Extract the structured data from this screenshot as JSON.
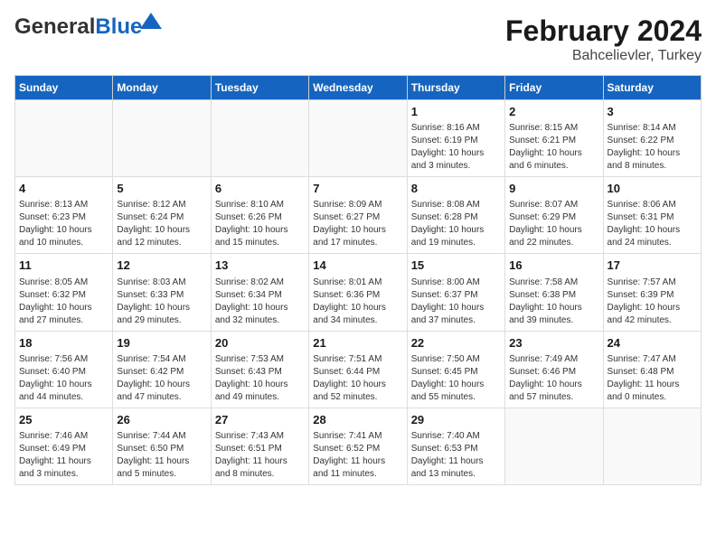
{
  "header": {
    "logo_general": "General",
    "logo_blue": "Blue",
    "month_title": "February 2024",
    "location": "Bahcelievler, Turkey"
  },
  "calendar": {
    "headers": [
      "Sunday",
      "Monday",
      "Tuesday",
      "Wednesday",
      "Thursday",
      "Friday",
      "Saturday"
    ],
    "weeks": [
      [
        {
          "day": "",
          "info": ""
        },
        {
          "day": "",
          "info": ""
        },
        {
          "day": "",
          "info": ""
        },
        {
          "day": "",
          "info": ""
        },
        {
          "day": "1",
          "info": "Sunrise: 8:16 AM\nSunset: 6:19 PM\nDaylight: 10 hours\nand 3 minutes."
        },
        {
          "day": "2",
          "info": "Sunrise: 8:15 AM\nSunset: 6:21 PM\nDaylight: 10 hours\nand 6 minutes."
        },
        {
          "day": "3",
          "info": "Sunrise: 8:14 AM\nSunset: 6:22 PM\nDaylight: 10 hours\nand 8 minutes."
        }
      ],
      [
        {
          "day": "4",
          "info": "Sunrise: 8:13 AM\nSunset: 6:23 PM\nDaylight: 10 hours\nand 10 minutes."
        },
        {
          "day": "5",
          "info": "Sunrise: 8:12 AM\nSunset: 6:24 PM\nDaylight: 10 hours\nand 12 minutes."
        },
        {
          "day": "6",
          "info": "Sunrise: 8:10 AM\nSunset: 6:26 PM\nDaylight: 10 hours\nand 15 minutes."
        },
        {
          "day": "7",
          "info": "Sunrise: 8:09 AM\nSunset: 6:27 PM\nDaylight: 10 hours\nand 17 minutes."
        },
        {
          "day": "8",
          "info": "Sunrise: 8:08 AM\nSunset: 6:28 PM\nDaylight: 10 hours\nand 19 minutes."
        },
        {
          "day": "9",
          "info": "Sunrise: 8:07 AM\nSunset: 6:29 PM\nDaylight: 10 hours\nand 22 minutes."
        },
        {
          "day": "10",
          "info": "Sunrise: 8:06 AM\nSunset: 6:31 PM\nDaylight: 10 hours\nand 24 minutes."
        }
      ],
      [
        {
          "day": "11",
          "info": "Sunrise: 8:05 AM\nSunset: 6:32 PM\nDaylight: 10 hours\nand 27 minutes."
        },
        {
          "day": "12",
          "info": "Sunrise: 8:03 AM\nSunset: 6:33 PM\nDaylight: 10 hours\nand 29 minutes."
        },
        {
          "day": "13",
          "info": "Sunrise: 8:02 AM\nSunset: 6:34 PM\nDaylight: 10 hours\nand 32 minutes."
        },
        {
          "day": "14",
          "info": "Sunrise: 8:01 AM\nSunset: 6:36 PM\nDaylight: 10 hours\nand 34 minutes."
        },
        {
          "day": "15",
          "info": "Sunrise: 8:00 AM\nSunset: 6:37 PM\nDaylight: 10 hours\nand 37 minutes."
        },
        {
          "day": "16",
          "info": "Sunrise: 7:58 AM\nSunset: 6:38 PM\nDaylight: 10 hours\nand 39 minutes."
        },
        {
          "day": "17",
          "info": "Sunrise: 7:57 AM\nSunset: 6:39 PM\nDaylight: 10 hours\nand 42 minutes."
        }
      ],
      [
        {
          "day": "18",
          "info": "Sunrise: 7:56 AM\nSunset: 6:40 PM\nDaylight: 10 hours\nand 44 minutes."
        },
        {
          "day": "19",
          "info": "Sunrise: 7:54 AM\nSunset: 6:42 PM\nDaylight: 10 hours\nand 47 minutes."
        },
        {
          "day": "20",
          "info": "Sunrise: 7:53 AM\nSunset: 6:43 PM\nDaylight: 10 hours\nand 49 minutes."
        },
        {
          "day": "21",
          "info": "Sunrise: 7:51 AM\nSunset: 6:44 PM\nDaylight: 10 hours\nand 52 minutes."
        },
        {
          "day": "22",
          "info": "Sunrise: 7:50 AM\nSunset: 6:45 PM\nDaylight: 10 hours\nand 55 minutes."
        },
        {
          "day": "23",
          "info": "Sunrise: 7:49 AM\nSunset: 6:46 PM\nDaylight: 10 hours\nand 57 minutes."
        },
        {
          "day": "24",
          "info": "Sunrise: 7:47 AM\nSunset: 6:48 PM\nDaylight: 11 hours\nand 0 minutes."
        }
      ],
      [
        {
          "day": "25",
          "info": "Sunrise: 7:46 AM\nSunset: 6:49 PM\nDaylight: 11 hours\nand 3 minutes."
        },
        {
          "day": "26",
          "info": "Sunrise: 7:44 AM\nSunset: 6:50 PM\nDaylight: 11 hours\nand 5 minutes."
        },
        {
          "day": "27",
          "info": "Sunrise: 7:43 AM\nSunset: 6:51 PM\nDaylight: 11 hours\nand 8 minutes."
        },
        {
          "day": "28",
          "info": "Sunrise: 7:41 AM\nSunset: 6:52 PM\nDaylight: 11 hours\nand 11 minutes."
        },
        {
          "day": "29",
          "info": "Sunrise: 7:40 AM\nSunset: 6:53 PM\nDaylight: 11 hours\nand 13 minutes."
        },
        {
          "day": "",
          "info": ""
        },
        {
          "day": "",
          "info": ""
        }
      ]
    ]
  }
}
